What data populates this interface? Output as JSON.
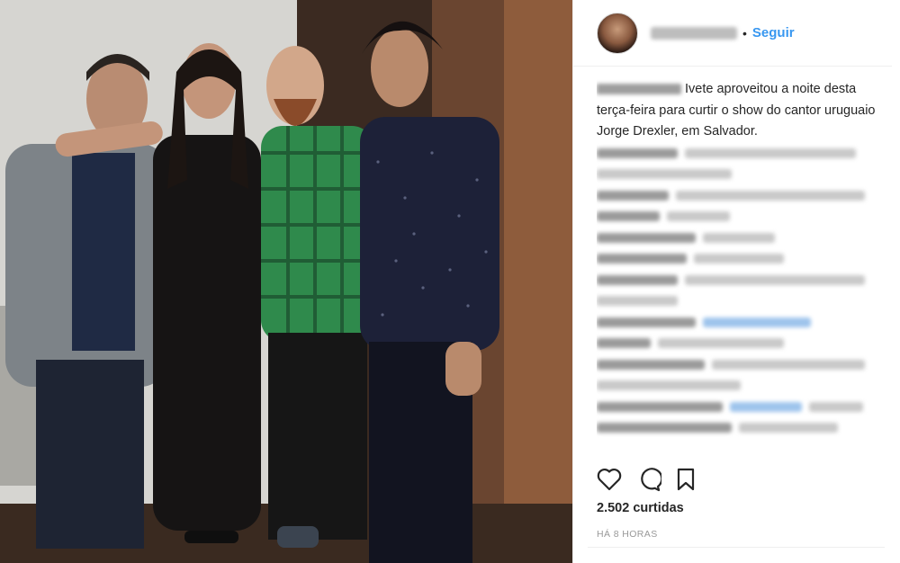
{
  "post": {
    "username": "ivetesangalo",
    "follow_label": "Seguir",
    "separator": "•",
    "caption": "Ivete aproveitou a noite desta terça-feira para curtir o show do cantor uruguaio Jorge Drexler, em Salvador.",
    "likes": "2.502 curtidas",
    "timestamp": "HÁ 8 HORAS"
  },
  "icons": {
    "like": "heart-icon",
    "comment": "comment-icon",
    "save": "bookmark-icon"
  },
  "colors": {
    "follow_blue": "#3897f0",
    "text": "#262626",
    "muted": "#999999",
    "divider": "#efefef"
  }
}
